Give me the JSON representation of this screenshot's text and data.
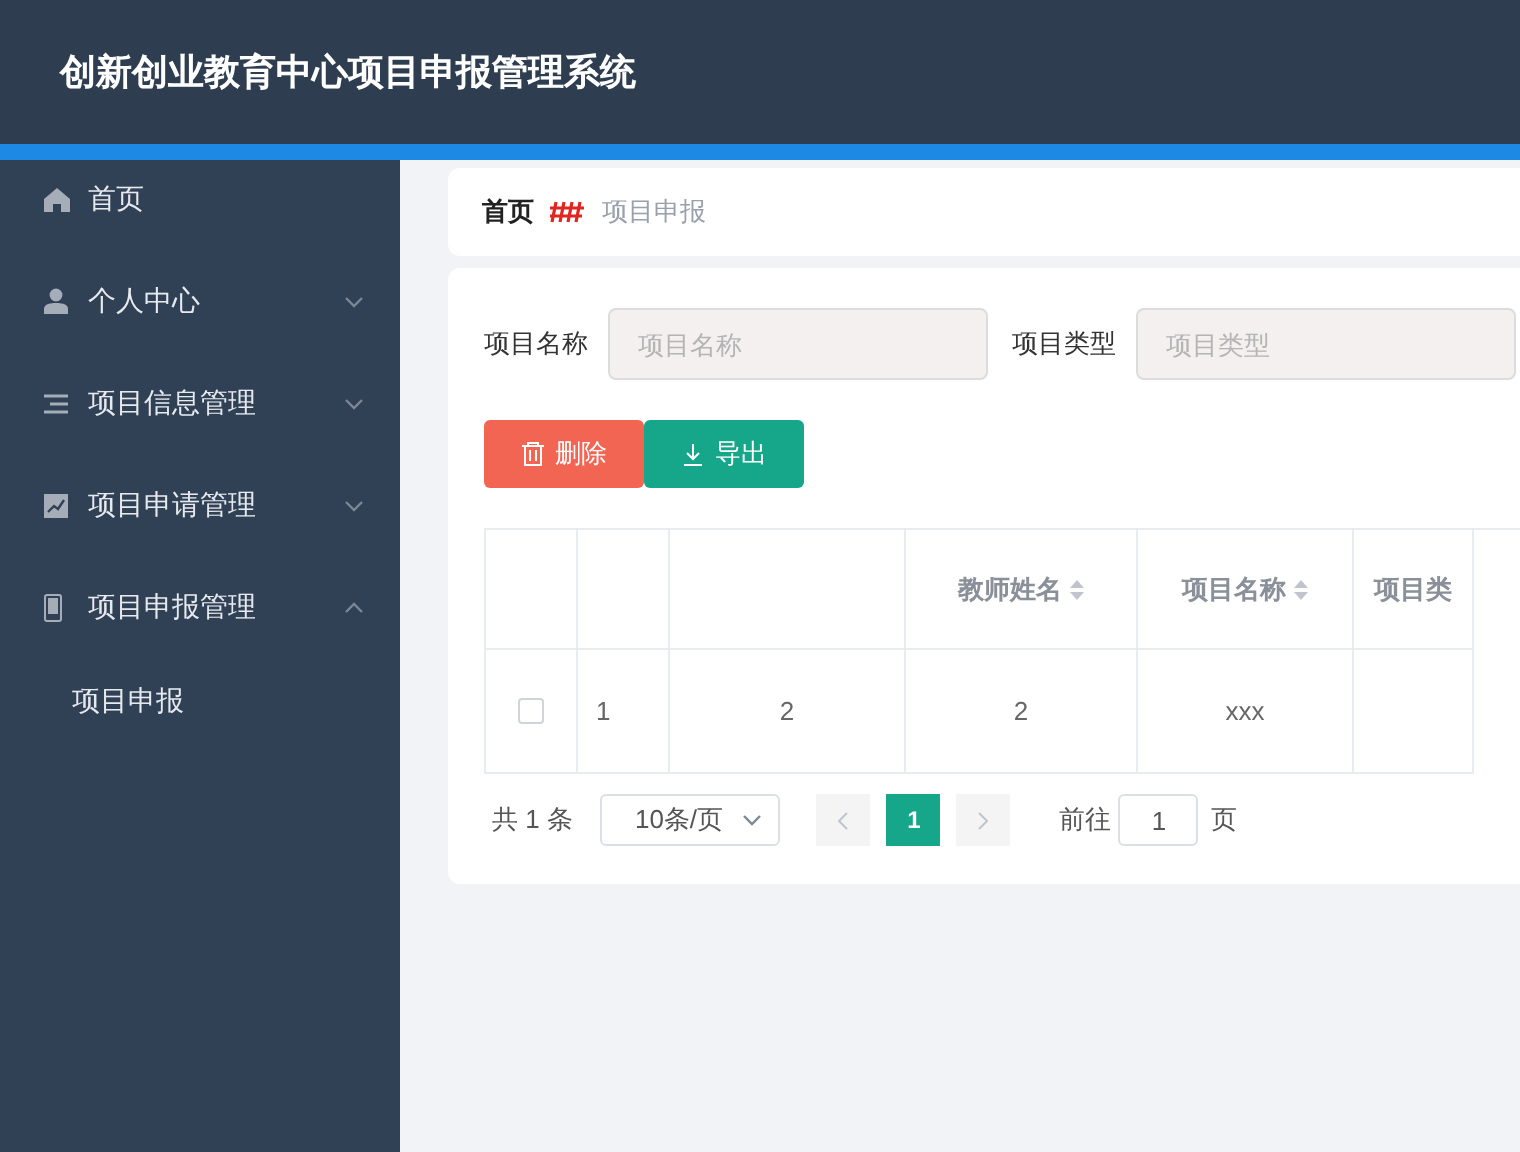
{
  "header": {
    "title": "创新创业教育中心项目申报管理系统"
  },
  "sidebar": {
    "items": [
      {
        "label": "首页"
      },
      {
        "label": "个人中心",
        "expanded": false
      },
      {
        "label": "项目信息管理",
        "expanded": false
      },
      {
        "label": "项目申请管理",
        "expanded": false
      },
      {
        "label": "项目申报管理",
        "expanded": true,
        "children": [
          {
            "label": "项目申报"
          }
        ]
      }
    ]
  },
  "breadcrumb": [
    "首页",
    "项目申报"
  ],
  "search": {
    "fields": [
      {
        "label": "项目名称",
        "placeholder": "项目名称"
      },
      {
        "label": "项目类型",
        "placeholder": "项目类型"
      }
    ]
  },
  "actions": [
    {
      "label": "删除",
      "kind": "delete"
    },
    {
      "label": "导出",
      "kind": "export"
    }
  ],
  "table": {
    "columns": [
      {
        "kind": "index"
      },
      {
        "kind": "text"
      },
      {
        "kind": "text",
        "label": "教师姓名"
      },
      {
        "kind": "text",
        "label": "项目名称"
      },
      {
        "kind": "text",
        "label": "项目类"
      }
    ],
    "rows": [
      {
        "checked": false,
        "cells": [
          "1",
          "2",
          "2",
          "xxx"
        ]
      }
    ]
  },
  "pagination": {
    "total": "共 1 条",
    "page_size": "10条/页",
    "pages": [
      {
        "label": "1",
        "selected": true
      }
    ],
    "goto_label": "前往",
    "goto_value": "1",
    "goto_suffix": "页"
  }
}
